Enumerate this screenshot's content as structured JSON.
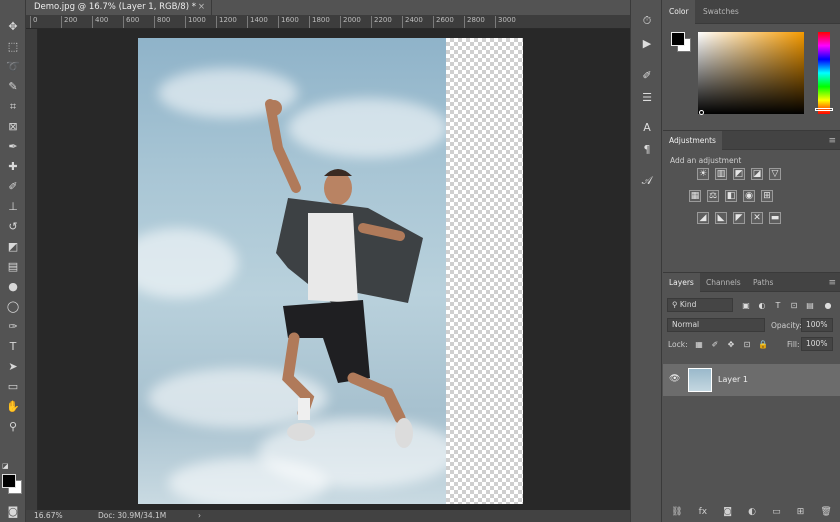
{
  "document": {
    "tab_title": "Demo.jpg @ 16.7% (Layer 1, RGB/8) *",
    "close_symbol": "×"
  },
  "ruler": {
    "ticks": [
      "0",
      "200",
      "400",
      "600",
      "800",
      "1000",
      "1200",
      "1400",
      "1600",
      "1800",
      "2000",
      "2200",
      "2400",
      "2600",
      "2800",
      "3000"
    ]
  },
  "status_bar": {
    "zoom": "16.67%",
    "doc_size": "Doc: 30.9M/34.1M",
    "arrow": "›"
  },
  "panels": {
    "color": {
      "tabs": [
        "Color",
        "Swatches"
      ]
    },
    "adjustments": {
      "title": "Adjustments",
      "subtitle": "Add an adjustment",
      "row1": [
        "☀",
        "▥",
        "◩",
        "◪",
        "▽"
      ],
      "row2": [
        "▦",
        "⚖",
        "◧",
        "◉",
        "⊞"
      ],
      "row3": [
        "◢",
        "◣",
        "◤",
        "✕",
        "▬"
      ]
    },
    "layers": {
      "tabs": [
        "Layers",
        "Channels",
        "Paths"
      ],
      "kind_filter": "Kind",
      "blend_mode": "Normal",
      "opacity_label": "Opacity:",
      "opacity_value": "100%",
      "lock_label": "Lock:",
      "fill_label": "Fill:",
      "fill_value": "100%",
      "layer_name": "Layer 1"
    }
  },
  "colors": {
    "foreground": "#000000",
    "background": "#ffffff",
    "ui_panel": "#535353",
    "canvas_bg": "#282828"
  },
  "icons": {
    "tools": [
      "move-icon",
      "marquee-icon",
      "lasso-icon",
      "quick-select-icon",
      "crop-icon",
      "frame-icon",
      "eyedropper-icon",
      "healing-icon",
      "brush-icon",
      "stamp-icon",
      "history-brush-icon",
      "eraser-icon",
      "gradient-icon",
      "blur-icon",
      "dodge-icon",
      "pen-icon",
      "type-icon",
      "path-select-icon",
      "shape-icon",
      "hand-icon",
      "zoom-icon"
    ]
  }
}
